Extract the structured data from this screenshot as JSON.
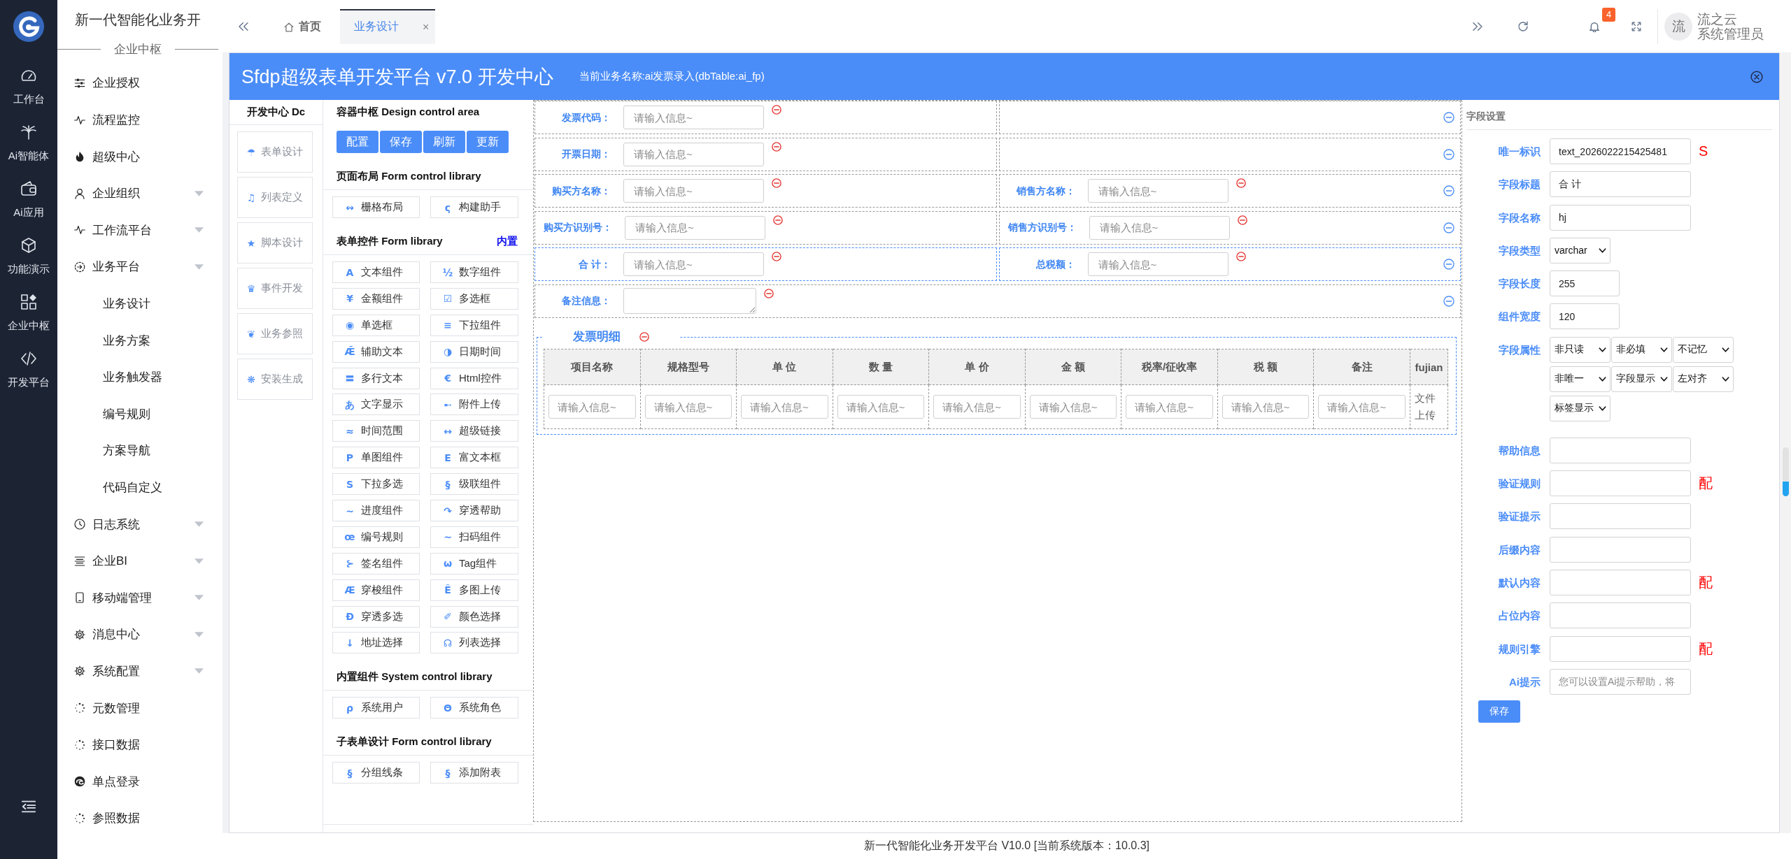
{
  "rail": {
    "items": [
      {
        "label": "工作台"
      },
      {
        "label": "Ai智能体"
      },
      {
        "label": "Ai应用"
      },
      {
        "label": "功能演示"
      },
      {
        "label": "企业中枢"
      },
      {
        "label": "开发平台"
      }
    ]
  },
  "menu": {
    "title": "新一代智能化业务开",
    "section": "企业中枢",
    "items": [
      {
        "label": "企业授权",
        "kind": "link"
      },
      {
        "label": "流程监控",
        "kind": "link"
      },
      {
        "label": "超级中心",
        "kind": "link"
      },
      {
        "label": "企业组织",
        "kind": "group"
      },
      {
        "label": "工作流平台",
        "kind": "group"
      },
      {
        "label": "业务平台",
        "kind": "group",
        "children": [
          {
            "label": "业务设计"
          },
          {
            "label": "业务方案"
          },
          {
            "label": "业务触发器"
          },
          {
            "label": "编号规则"
          },
          {
            "label": "方案导航"
          },
          {
            "label": "代码自定义"
          }
        ]
      },
      {
        "label": "日志系统",
        "kind": "group"
      },
      {
        "label": "企业BI",
        "kind": "group"
      },
      {
        "label": "移动端管理",
        "kind": "group"
      },
      {
        "label": "消息中心",
        "kind": "group"
      },
      {
        "label": "系统配置",
        "kind": "group"
      },
      {
        "label": "元数管理",
        "kind": "link"
      },
      {
        "label": "接口数据",
        "kind": "link"
      },
      {
        "label": "单点登录",
        "kind": "link"
      },
      {
        "label": "参照数据",
        "kind": "link"
      }
    ]
  },
  "header": {
    "tabs": [
      {
        "label": "首页",
        "kind": "home",
        "selected": false
      },
      {
        "label": "业务设计",
        "kind": "page",
        "selected": true,
        "close": "×"
      }
    ],
    "badge": "4",
    "user": {
      "avatar": "流",
      "name": "流之云",
      "role": "系统管理员"
    }
  },
  "dialog": {
    "title": "Sfdp超级表单开发平台 v7.0 开发中心",
    "subtitle": "当前业务名称:ai发票录入(dbTable:ai_fp)",
    "dev_center": {
      "title": "开发中心 Dc",
      "items": [
        {
          "glyph": "☂",
          "label": "表单设计"
        },
        {
          "glyph": "♫",
          "label": "列表定义"
        },
        {
          "glyph": "★",
          "label": "脚本设计"
        },
        {
          "glyph": "♛",
          "label": "事件开发"
        },
        {
          "glyph": "❦",
          "label": "业务参照"
        },
        {
          "glyph": "❋",
          "label": "安装生成"
        }
      ]
    },
    "design_area": {
      "title": "容器中枢 Design control area",
      "buttons": [
        "配置",
        "保存",
        "刷新",
        "更新"
      ],
      "sections": [
        {
          "title": "页面布局 Form control library",
          "controls": [
            {
              "glyph": "↭",
              "label": "栅格布局"
            },
            {
              "glyph": "ς",
              "label": "构建助手"
            }
          ]
        },
        {
          "title": "表单控件 Form library",
          "link": "内置",
          "controls": [
            {
              "glyph": "A",
              "label": "文本组件"
            },
            {
              "glyph": "½",
              "label": "数字组件"
            },
            {
              "glyph": "¥",
              "label": "金额组件"
            },
            {
              "glyph": "☑",
              "label": "多选框"
            },
            {
              "glyph": "◉",
              "label": "单选框"
            },
            {
              "glyph": "≡",
              "label": "下拉组件"
            },
            {
              "glyph": "Ǣ",
              "label": "辅助文本"
            },
            {
              "glyph": "◑",
              "label": "日期时间"
            },
            {
              "glyph": "〓",
              "label": "多行文本"
            },
            {
              "glyph": "€",
              "label": "Html控件"
            },
            {
              "glyph": "あ",
              "label": "文字显示"
            },
            {
              "glyph": "➸",
              "label": "附件上传"
            },
            {
              "glyph": "≈",
              "label": "时间范围"
            },
            {
              "glyph": "↔",
              "label": "超级链接"
            },
            {
              "glyph": "P",
              "label": "单图组件"
            },
            {
              "glyph": "E",
              "label": "富文本框"
            },
            {
              "glyph": "S",
              "label": "下拉多选"
            },
            {
              "glyph": "§",
              "label": "级联组件"
            },
            {
              "glyph": "~",
              "label": "进度组件"
            },
            {
              "glyph": "↷",
              "label": "穿透帮助"
            },
            {
              "glyph": "œ",
              "label": "编号规则"
            },
            {
              "glyph": "~",
              "label": "扫码组件"
            },
            {
              "glyph": "⊱",
              "label": "签名组件"
            },
            {
              "glyph": "ω",
              "label": "Tag组件"
            },
            {
              "glyph": "Æ",
              "label": "穿梭组件"
            },
            {
              "glyph": "Ê",
              "label": "多图上传"
            },
            {
              "glyph": "Đ",
              "label": "穿透多选"
            },
            {
              "glyph": "✐",
              "label": "颜色选择"
            },
            {
              "glyph": "↓",
              "label": "地址选择"
            },
            {
              "glyph": "☊",
              "label": "列表选择"
            }
          ]
        },
        {
          "title": "内置组件 System control library",
          "controls": [
            {
              "glyph": "ρ",
              "label": "系统用户"
            },
            {
              "glyph": "Θ",
              "label": "系统角色"
            }
          ]
        },
        {
          "title": "子表单设计 Form control library",
          "controls": [
            {
              "glyph": "§",
              "label": "分组线条"
            },
            {
              "glyph": "§",
              "label": "添加附表"
            }
          ]
        }
      ]
    },
    "canvas": {
      "rows": [
        {
          "selected": false,
          "cells": [
            {
              "kind": "input",
              "label": "发票代码：",
              "placeholder": "请输入信息~"
            },
            {
              "kind": "empty"
            }
          ]
        },
        {
          "selected": false,
          "cells": [
            {
              "kind": "input",
              "label": "开票日期：",
              "placeholder": "请输入信息~"
            },
            {
              "kind": "empty"
            }
          ]
        },
        {
          "selected": false,
          "cells": [
            {
              "kind": "input",
              "label": "购买方名称：",
              "placeholder": "请输入信息~"
            },
            {
              "kind": "input",
              "label": "销售方名称：",
              "placeholder": "请输入信息~"
            }
          ]
        },
        {
          "selected": false,
          "cells": [
            {
              "kind": "input",
              "label": "购买方识别号：",
              "placeholder": "请输入信息~"
            },
            {
              "kind": "input",
              "label": "销售方识别号：",
              "placeholder": "请输入信息~"
            }
          ]
        },
        {
          "selected": true,
          "cells": [
            {
              "kind": "input",
              "label": "合 计：",
              "placeholder": "请输入信息~"
            },
            {
              "kind": "input",
              "label": "总税额：",
              "placeholder": "请输入信息~"
            }
          ]
        },
        {
          "selected": false,
          "cells": [
            {
              "kind": "textarea",
              "label": "备注信息："
            }
          ]
        }
      ],
      "subtable": {
        "title": "发票明细",
        "columns": [
          "项目名称",
          "规格型号",
          "单 位",
          "数 量",
          "单 价",
          "金 额",
          "税率/征收率",
          "税 额",
          "备注",
          "fujian"
        ],
        "cells": [
          {
            "kind": "input",
            "placeholder": "请输入信息~"
          },
          {
            "kind": "input",
            "placeholder": "请输入信息~"
          },
          {
            "kind": "input",
            "placeholder": "请输入信息~"
          },
          {
            "kind": "input",
            "placeholder": "请输入信息~"
          },
          {
            "kind": "input",
            "placeholder": "请输入信息~"
          },
          {
            "kind": "input",
            "placeholder": "请输入信息~"
          },
          {
            "kind": "input",
            "placeholder": "请输入信息~"
          },
          {
            "kind": "input",
            "placeholder": "请输入信息~"
          },
          {
            "kind": "input",
            "placeholder": "请输入信息~"
          },
          {
            "kind": "text",
            "text": "文件上传"
          }
        ]
      }
    },
    "field_settings": {
      "title": "字段设置",
      "rows": [
        {
          "label": "唯一标识",
          "kind": "text",
          "value": "text_2026022215425481",
          "note": "S"
        },
        {
          "label": "字段标题",
          "kind": "text",
          "value": "合 计"
        },
        {
          "label": "字段名称",
          "kind": "text",
          "value": "hj"
        },
        {
          "label": "字段类型",
          "kind": "select",
          "values": [
            "varchar"
          ]
        },
        {
          "label": "字段长度",
          "kind": "number",
          "value": "255"
        },
        {
          "label": "组件宽度",
          "kind": "number",
          "value": "120"
        },
        {
          "label": "字段属性",
          "kind": "select",
          "values": [
            "非只读",
            "非必填",
            "不记忆",
            "非唯一",
            "字段显示",
            "左对齐",
            "标签显示"
          ]
        },
        {
          "label": "帮助信息",
          "kind": "text"
        },
        {
          "label": "验证规则",
          "kind": "text",
          "note": "配"
        },
        {
          "label": "验证提示",
          "kind": "text"
        },
        {
          "label": "后缀内容",
          "kind": "text"
        },
        {
          "label": "默认内容",
          "kind": "text",
          "note": "配"
        },
        {
          "label": "占位内容",
          "kind": "text"
        },
        {
          "label": "规则引擎",
          "kind": "text",
          "note": "配"
        },
        {
          "label": "Ai提示",
          "kind": "text",
          "placeholder": "您可以设置Ai提示帮助，将"
        }
      ],
      "save": "保存"
    }
  },
  "footer": "新一代智能化业务开发平台 V10.0 [当前系统版本：10.0.3]"
}
